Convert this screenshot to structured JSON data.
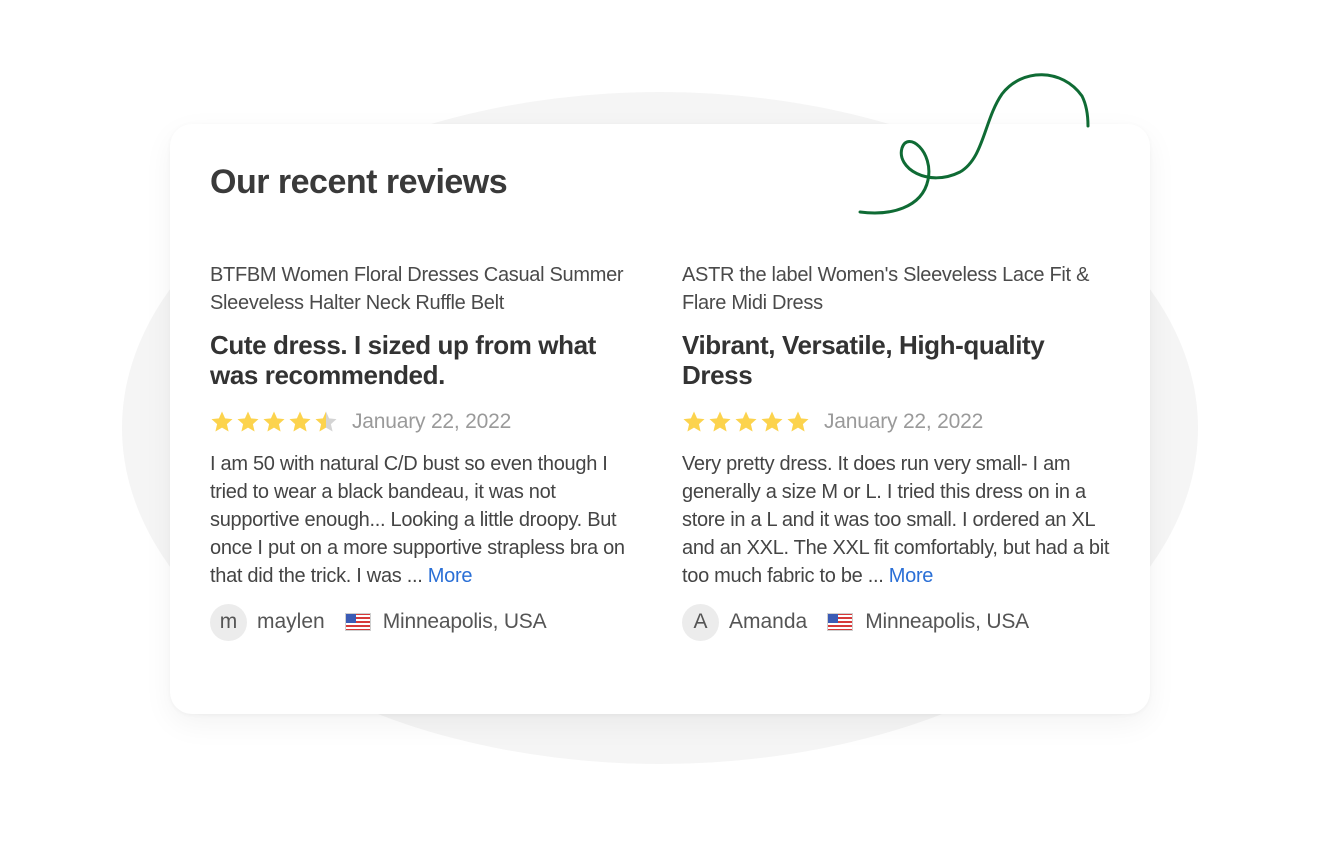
{
  "section": {
    "title": "Our recent reviews"
  },
  "colors": {
    "star": "#fcd34d",
    "star_empty": "#d4d4d4",
    "link": "#2a6fd6",
    "squiggle": "#0f6b34"
  },
  "reviews": [
    {
      "product": "BTFBM Women Floral Dresses Casual Summer Sleeveless Halter Neck Ruffle Belt",
      "headline": "Cute dress. I sized up from what was recommended.",
      "rating": 4.5,
      "date": "January 22, 2022",
      "body": "I am 50 with natural C/D bust so even though I tried to wear a black bandeau, it was not supportive enough... Looking a little droopy. But once I put on a more supportive strapless bra on that did the trick. I was ...",
      "more_label": "More",
      "avatar_initial": "m",
      "username": "maylen",
      "flag_icon": "us-flag-icon",
      "location": "Minneapolis, USA"
    },
    {
      "product": "ASTR the label Women's Sleeveless Lace Fit & Flare Midi Dress",
      "headline": "Vibrant, Versatile, High-quality Dress",
      "rating": 5,
      "date": "January 22, 2022",
      "body": "Very pretty dress. It does run very small- I am generally a size M or L. I tried this dress on in a store in a L and it was too small. I ordered an XL and an XXL. The XXL fit comfortably, but had a bit too much fabric to be ...",
      "more_label": "More",
      "avatar_initial": "A",
      "username": "Amanda",
      "flag_icon": "us-flag-icon",
      "location": "Minneapolis, USA"
    }
  ]
}
